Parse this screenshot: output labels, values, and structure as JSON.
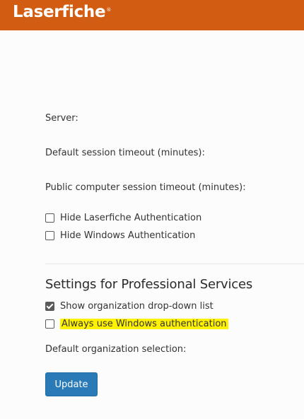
{
  "brand": {
    "logo_text": "Laserfiche",
    "logo_mark": "®",
    "colors": {
      "topbar": "#d25d12",
      "button": "#2a7ab8",
      "highlight": "#fff200"
    }
  },
  "settings": {
    "server_label": "Server:",
    "default_timeout_label": "Default session timeout (minutes):",
    "public_timeout_label": "Public computer session timeout (minutes):",
    "hide_laserfiche_auth": {
      "label": "Hide Laserfiche Authentication",
      "checked": false
    },
    "hide_windows_auth": {
      "label": "Hide Windows Authentication",
      "checked": false
    }
  },
  "professional_services": {
    "title": "Settings for Professional Services",
    "show_org_dropdown": {
      "label": "Show organization drop-down list",
      "checked": true
    },
    "always_windows_auth": {
      "label": "Always use Windows authentication",
      "checked": false,
      "highlighted": true
    },
    "default_org_label": "Default organization selection:"
  },
  "actions": {
    "update_label": "Update"
  }
}
